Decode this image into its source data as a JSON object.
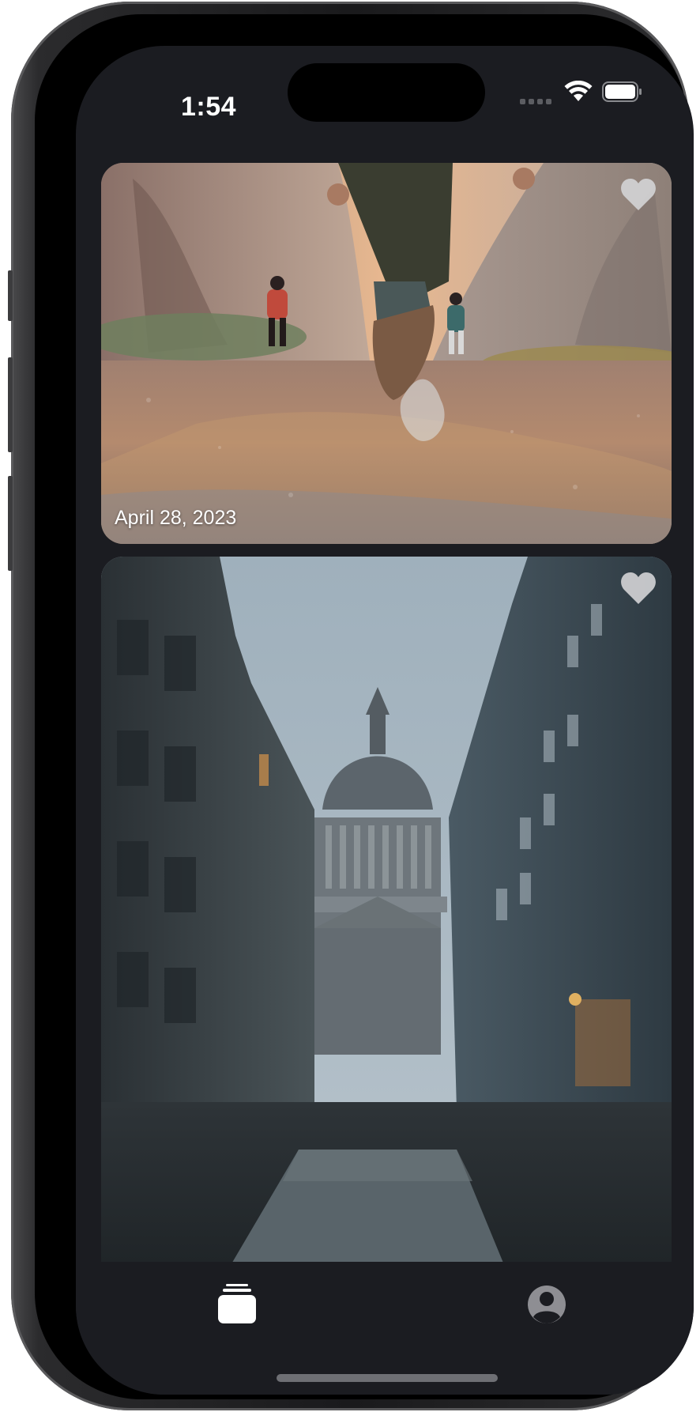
{
  "status_bar": {
    "time": "1:54",
    "wifi_icon": "wifi-icon",
    "battery_icon": "battery-icon",
    "signal_icon": "cellular-dots-icon"
  },
  "feed": {
    "cards": [
      {
        "image": "canyon-hikers-photo",
        "date": "April 28, 2023",
        "favorite_icon": "heart-icon"
      },
      {
        "image": "pantheon-street-photo",
        "favorite_icon": "heart-icon"
      }
    ]
  },
  "tab_bar": {
    "items": [
      {
        "icon": "stack-icon",
        "selected": true
      },
      {
        "icon": "person-circle-icon",
        "selected": false
      }
    ]
  },
  "colors": {
    "background": "#1b1c21",
    "tab_active": "#ffffff",
    "tab_inactive": "#8e8e93",
    "heart": "#d4d4d6"
  }
}
